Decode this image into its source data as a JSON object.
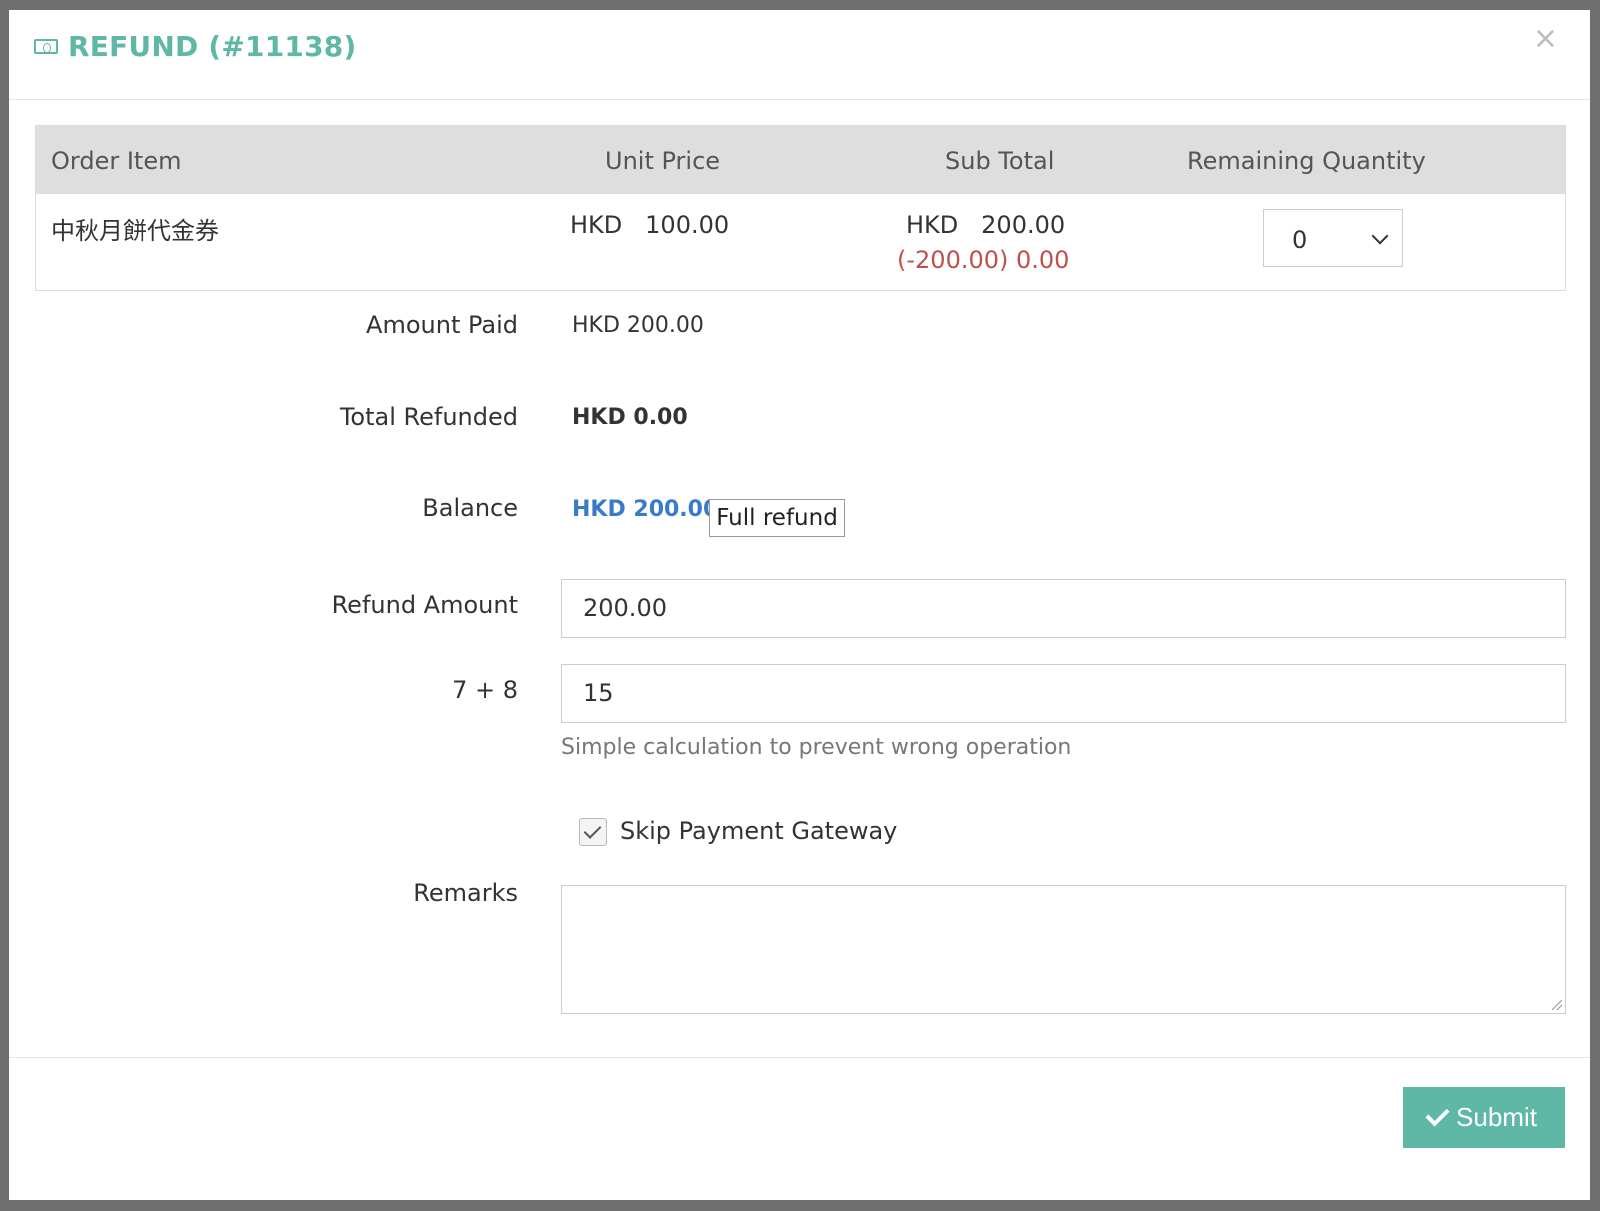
{
  "modal": {
    "title": "REFUND (#11138)",
    "close_symbol": "×"
  },
  "table": {
    "headers": [
      "Order Item",
      "Unit Price",
      "Sub Total",
      "Remaining Quantity"
    ],
    "row": {
      "item": "中秋月餅代金券",
      "unit_price": "HKD   100.00",
      "sub_total": "HKD   200.00",
      "sub_total_adjusted": "(-200.00) 0.00",
      "remaining_quantity": "0"
    }
  },
  "form": {
    "amount_paid_label": "Amount Paid",
    "amount_paid_value": "HKD 200.00",
    "total_refunded_label": "Total Refunded",
    "total_refunded_value": "HKD 0.00",
    "balance_label": "Balance",
    "balance_value": "HKD 200.00",
    "full_refund_label": "Full refund",
    "refund_amount_label": "Refund Amount",
    "refund_amount_value": "200.00",
    "captcha_label": "7 + 8",
    "captcha_value": "15",
    "captcha_help": "Simple calculation to prevent wrong operation",
    "skip_gateway_label": "Skip Payment Gateway",
    "skip_gateway_checked": true,
    "remarks_label": "Remarks",
    "remarks_value": ""
  },
  "footer": {
    "submit_label": "Submit"
  },
  "colors": {
    "accent": "#5fb7a6",
    "balance_blue": "#3a7bc8",
    "negative_red": "#c0504d"
  },
  "icons": {
    "title": "money-icon",
    "close": "close-icon",
    "select": "chevron-down-icon",
    "submit": "check-icon"
  }
}
